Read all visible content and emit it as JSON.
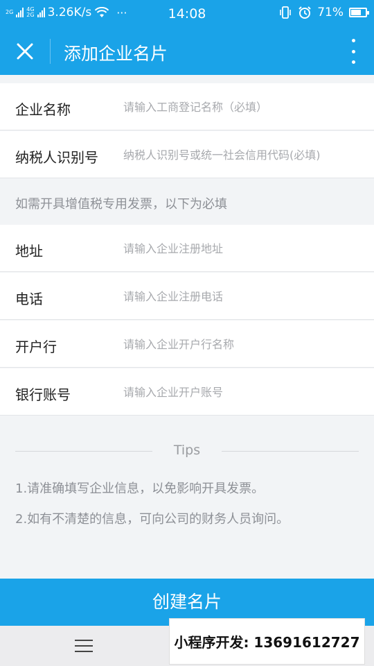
{
  "status_bar": {
    "net1": "2G",
    "net2": "4G",
    "net3": "2G",
    "speed": "3.26K/s",
    "dots": "···",
    "time": "14:08",
    "battery_percent": "71%",
    "battery_level": 71
  },
  "header": {
    "title": "添加企业名片"
  },
  "form": {
    "company_name": {
      "label": "企业名称",
      "placeholder": "请输入工商登记名称（必填）"
    },
    "tax_id": {
      "label": "纳税人识别号",
      "placeholder": "纳税人识别号或统一社会信用代码(必填)"
    },
    "vat_note": "如需开具增值税专用发票，以下为必填",
    "address": {
      "label": "地址",
      "placeholder": "请输入企业注册地址"
    },
    "phone": {
      "label": "电话",
      "placeholder": "请输入企业注册电话"
    },
    "bank": {
      "label": "开户行",
      "placeholder": "请输入企业开户行名称"
    },
    "account": {
      "label": "银行账号",
      "placeholder": "请输入企业开户账号"
    }
  },
  "tips": {
    "title": "Tips",
    "items": [
      "1.请准确填写企业信息，以免影响开具发票。",
      "2.如有不清楚的信息，可向公司的财务人员询问。"
    ]
  },
  "create_button": "创建名片",
  "promo": "小程序开发: 13691612727",
  "colors": {
    "accent": "#1aa3e8",
    "background": "#f2f4f6",
    "placeholder": "#a7a9ad"
  }
}
